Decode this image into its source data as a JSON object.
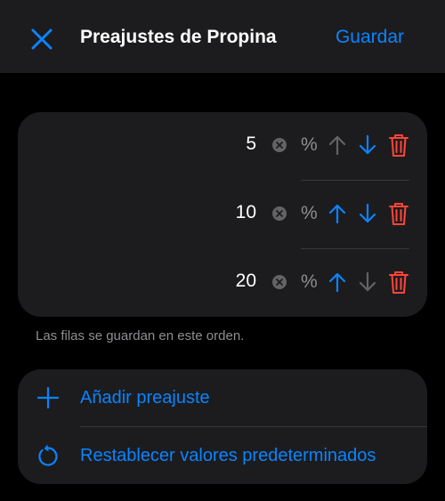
{
  "header": {
    "title": "Preajustes de Propina",
    "save_label": "Guardar",
    "close_icon": "close-icon"
  },
  "presets": [
    {
      "value": "5",
      "unit": "%",
      "up_enabled": false,
      "down_enabled": true
    },
    {
      "value": "10",
      "unit": "%",
      "up_enabled": true,
      "down_enabled": true
    },
    {
      "value": "20",
      "unit": "%",
      "up_enabled": true,
      "down_enabled": false
    }
  ],
  "footnote": "Las filas se guardan en este orden.",
  "actions": {
    "add_label": "Añadir preajuste",
    "reset_label": "Restablecer valores predeterminados"
  },
  "colors": {
    "accent": "#0a84ff",
    "destructive": "#ff453a",
    "disabled": "#636366",
    "card": "#1c1c1e",
    "background": "#000000"
  }
}
